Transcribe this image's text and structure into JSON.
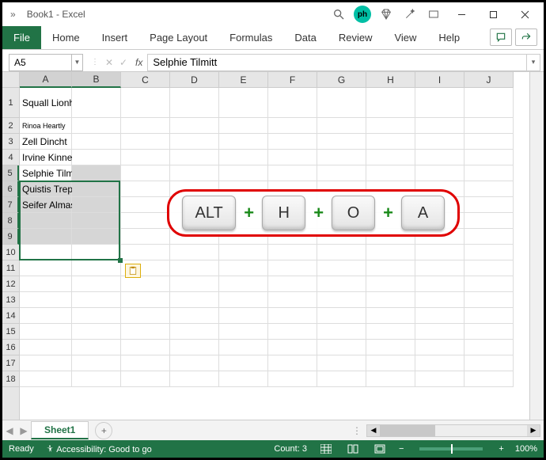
{
  "title": "Book1  -  Excel",
  "ribbon": {
    "file": "File",
    "tabs": [
      "Home",
      "Insert",
      "Page Layout",
      "Formulas",
      "Data",
      "Review",
      "View",
      "Help"
    ]
  },
  "namebox": "A5",
  "fx_label": "fx",
  "formula": "Selphie Tilmitt",
  "columns": [
    "A",
    "B",
    "C",
    "D",
    "E",
    "F",
    "G",
    "H",
    "I",
    "J"
  ],
  "rows": [
    "1",
    "2",
    "3",
    "4",
    "5",
    "6",
    "7",
    "8",
    "9",
    "10",
    "11",
    "12",
    "13",
    "14",
    "15",
    "16",
    "17",
    "18"
  ],
  "cells": {
    "A1": "Squall Lionheart",
    "A2": "Rinoa Heartly",
    "A3": "Zell Dincht",
    "A4": "Irvine Kinneas",
    "A5": "Selphie Tilmitt",
    "A6": "Quistis Trepe",
    "A7": "Seifer Almasy"
  },
  "selection": {
    "ref": "A5:B9",
    "active": "A5"
  },
  "shortcut": {
    "keys": [
      "ALT",
      "H",
      "O",
      "A"
    ],
    "separator": "+"
  },
  "sheet": {
    "active": "Sheet1",
    "add": "+"
  },
  "status": {
    "mode": "Ready",
    "accessibility": "Accessibility: Good to go",
    "count_label": "Count:",
    "count": "3",
    "zoom_minus": "−",
    "zoom_plus": "+",
    "zoom": "100%"
  },
  "icons": {
    "ph": "ph"
  }
}
